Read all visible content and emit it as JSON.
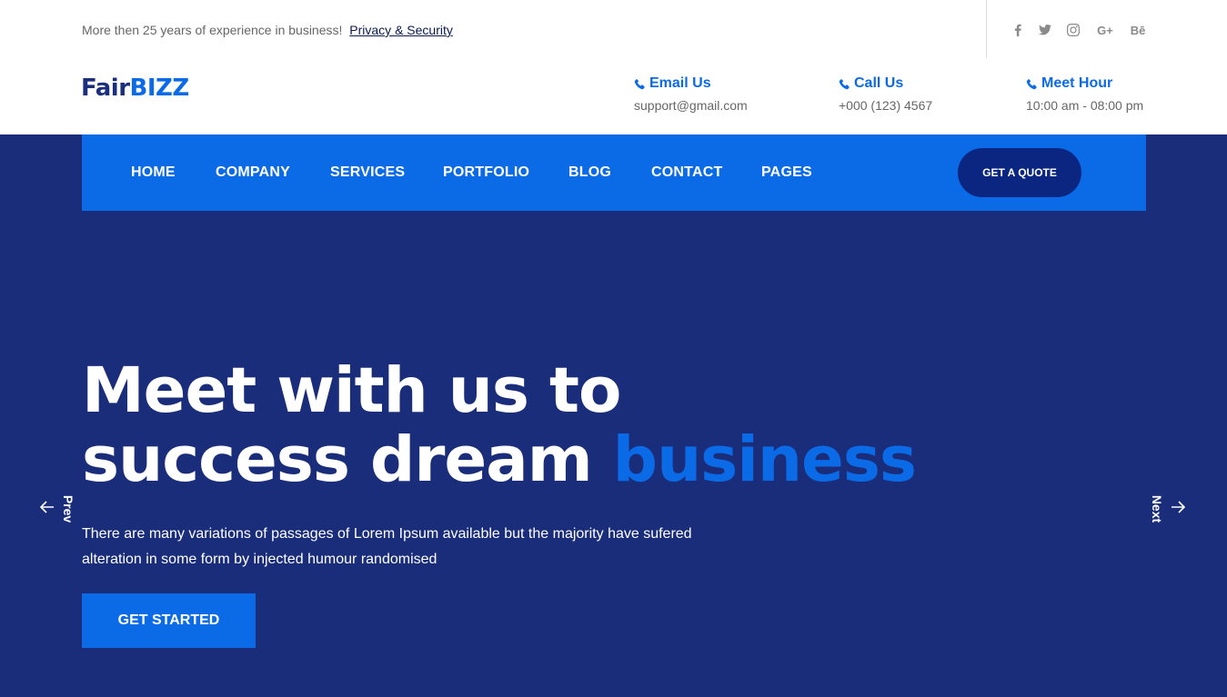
{
  "topbar": {
    "tagline": "More then 25 years of experience in business!",
    "link": "Privacy & Security",
    "social": [
      "facebook-icon",
      "twitter-icon",
      "instagram-icon",
      "google-plus-icon",
      "behance-icon"
    ],
    "gplus_label": "G+",
    "behance_label": "Bē"
  },
  "header": {
    "logo_part1": "Fair",
    "logo_part2": "BIZZ",
    "email": {
      "title": "Email Us",
      "value": "support@gmail.com"
    },
    "call": {
      "title": "Call Us",
      "value": "+000 (123) 4567"
    },
    "hours": {
      "title": "Meet Hour",
      "value": "10:00 am - 08:00 pm"
    }
  },
  "nav": {
    "items": [
      "HOME",
      "COMPANY",
      "SERVICES",
      "PORTFOLIO",
      "BLOG",
      "CONTACT",
      "PAGES"
    ],
    "quote": "GET A QUOTE"
  },
  "hero": {
    "line1": "Meet with us to",
    "line2": "success dream",
    "highlight": "business",
    "description": "There are many variations of passages of Lorem Ipsum available but the majority have sufered alteration in some form by injected humour randomised",
    "cta": "GET STARTED",
    "prev": "Prev",
    "next": "Next"
  },
  "colors": {
    "primary": "#0b6be6",
    "hero_bg": "#1a2d7b",
    "quote_bg": "#0a2680",
    "logo_dark": "#1b2f7d"
  }
}
